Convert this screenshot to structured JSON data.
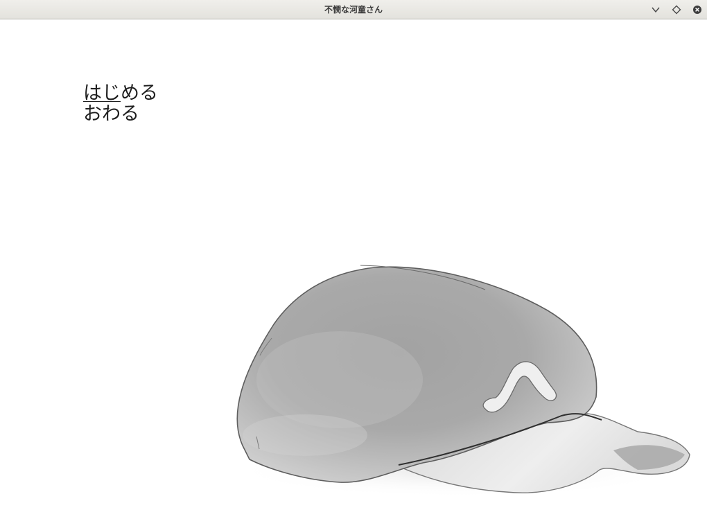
{
  "window": {
    "title": "不憫な河童さん",
    "controls": {
      "minimize_icon": "chevron-down-icon",
      "maximize_icon": "diamond-icon",
      "close_icon": "close-circle-icon"
    }
  },
  "menu": {
    "items": [
      {
        "label_part1": "はじ",
        "label_part2": "める",
        "selected": true
      },
      {
        "label": "おわる",
        "selected": false
      }
    ]
  },
  "artwork": {
    "subject": "kappa-cap-illustration",
    "colors": {
      "cap_body": "#9c9c9c",
      "cap_highlight": "#d0d0d0",
      "brim": "#e4e4e4",
      "outline": "#555555"
    }
  }
}
